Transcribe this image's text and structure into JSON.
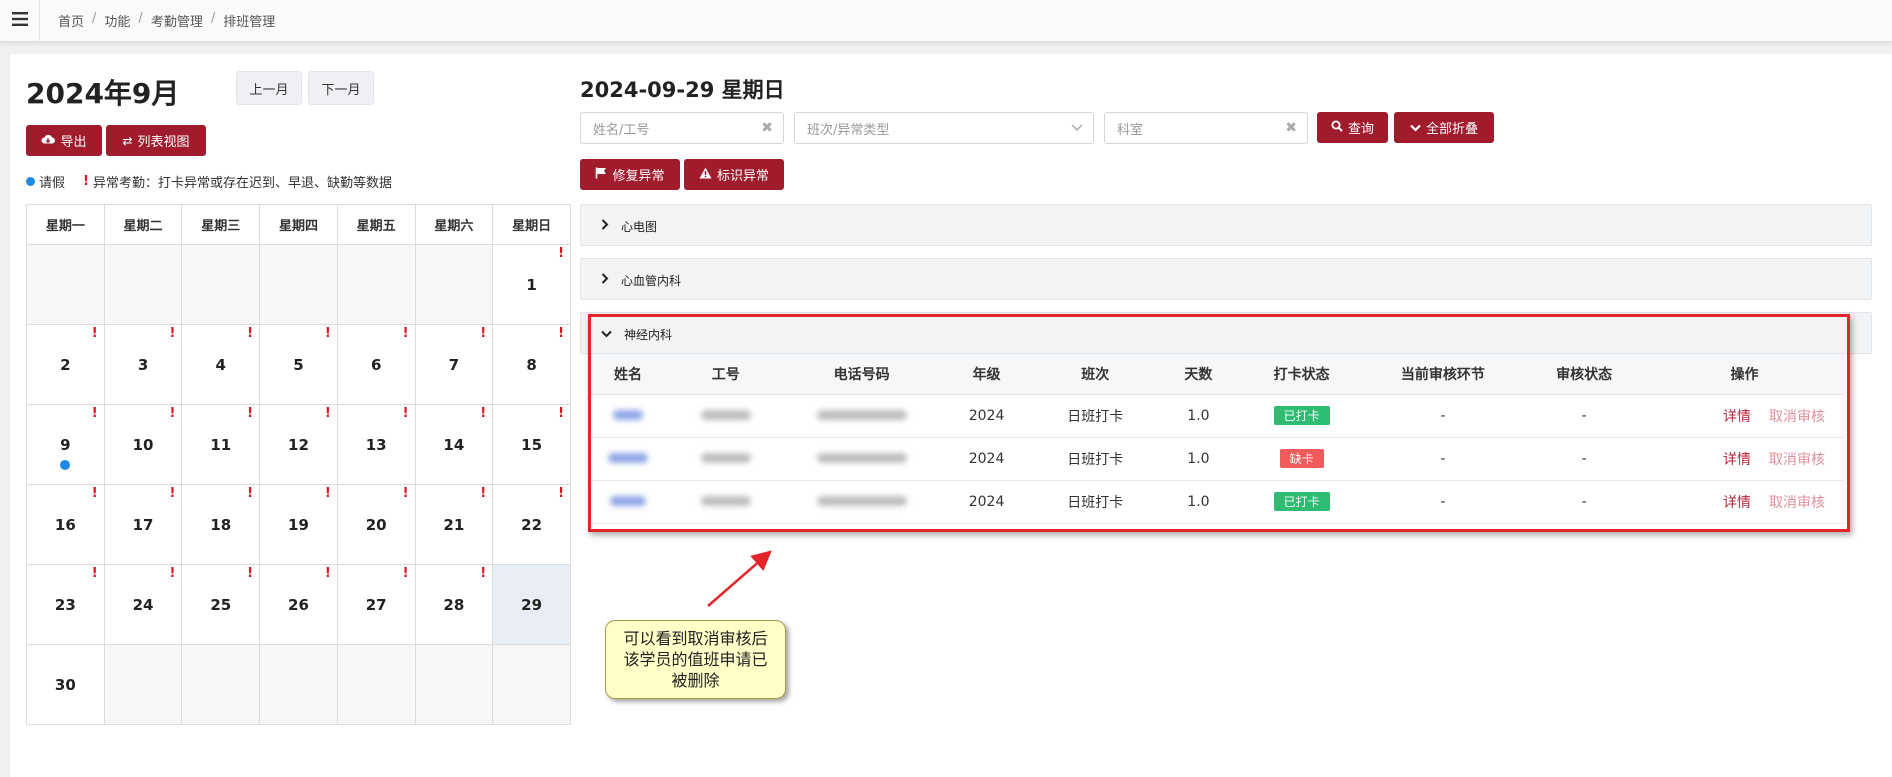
{
  "breadcrumb": [
    "首页",
    "功能",
    "考勤管理",
    "排班管理"
  ],
  "calendar": {
    "title": "2024年9月",
    "prev_label": "上一月",
    "next_label": "下一月",
    "export_label": "导出",
    "list_view_label": "列表视图",
    "legend_leave": "请假",
    "legend_abnormal": "异常考勤：打卡异常或存在迟到、早退、缺勤等数据",
    "weekdays": [
      "星期一",
      "星期二",
      "星期三",
      "星期四",
      "星期五",
      "星期六",
      "星期日"
    ],
    "weeks": [
      [
        {
          "d": ""
        },
        {
          "d": ""
        },
        {
          "d": ""
        },
        {
          "d": ""
        },
        {
          "d": ""
        },
        {
          "d": ""
        },
        {
          "d": "1",
          "m": true
        }
      ],
      [
        {
          "d": "2",
          "m": true
        },
        {
          "d": "3",
          "m": true
        },
        {
          "d": "4",
          "m": true
        },
        {
          "d": "5",
          "m": true
        },
        {
          "d": "6",
          "m": true
        },
        {
          "d": "7",
          "m": true
        },
        {
          "d": "8",
          "m": true
        }
      ],
      [
        {
          "d": "9",
          "m": true,
          "leave": true
        },
        {
          "d": "10",
          "m": true
        },
        {
          "d": "11",
          "m": true
        },
        {
          "d": "12",
          "m": true
        },
        {
          "d": "13",
          "m": true
        },
        {
          "d": "14",
          "m": true
        },
        {
          "d": "15",
          "m": true
        }
      ],
      [
        {
          "d": "16",
          "m": true
        },
        {
          "d": "17",
          "m": true
        },
        {
          "d": "18",
          "m": true
        },
        {
          "d": "19",
          "m": true
        },
        {
          "d": "20",
          "m": true
        },
        {
          "d": "21",
          "m": true
        },
        {
          "d": "22",
          "m": true
        }
      ],
      [
        {
          "d": "23",
          "m": true
        },
        {
          "d": "24",
          "m": true
        },
        {
          "d": "25",
          "m": true
        },
        {
          "d": "26",
          "m": true
        },
        {
          "d": "27",
          "m": true
        },
        {
          "d": "28",
          "m": true
        },
        {
          "d": "29",
          "m": false,
          "today": true
        }
      ],
      [
        {
          "d": "30"
        },
        {
          "d": ""
        },
        {
          "d": ""
        },
        {
          "d": ""
        },
        {
          "d": ""
        },
        {
          "d": ""
        },
        {
          "d": ""
        }
      ]
    ]
  },
  "detail": {
    "date_title": "2024-09-29 星期日",
    "name_placeholder": "姓名/工号",
    "shift_placeholder": "班次/异常类型",
    "dept_placeholder": "科室",
    "query_label": "查询",
    "collapse_label": "全部折叠",
    "fix_label": "修复异常",
    "mark_label": "标识异常",
    "groups": [
      {
        "name": "心电图",
        "expanded": false
      },
      {
        "name": "心血管内科",
        "expanded": false
      },
      {
        "name": "神经内科",
        "expanded": true
      }
    ],
    "columns": [
      "姓名",
      "工号",
      "电话号码",
      "年级",
      "班次",
      "天数",
      "打卡状态",
      "当前审核环节",
      "审核状态",
      "操作"
    ],
    "rows": [
      {
        "grade": "2024",
        "shift": "日班打卡",
        "days": "1.0",
        "status": "已打卡",
        "status_color": "#2dbd72",
        "stage": "-",
        "review": "-"
      },
      {
        "grade": "2024",
        "shift": "日班打卡",
        "days": "1.0",
        "status": "缺卡",
        "status_color": "#f05a5a",
        "stage": "-",
        "review": "-"
      },
      {
        "grade": "2024",
        "shift": "日班打卡",
        "days": "1.0",
        "status": "已打卡",
        "status_color": "#2dbd72",
        "stage": "-",
        "review": "-"
      }
    ],
    "action_detail": "详情",
    "action_cancel": "取消审核"
  },
  "annotation": {
    "callout_lines": [
      "可以看到取消审核后",
      "该学员的值班申请已",
      "被删除"
    ]
  },
  "colors": {
    "brand": "#a01c2c",
    "highlight": "#e3242b",
    "leave": "#1e88e5"
  }
}
